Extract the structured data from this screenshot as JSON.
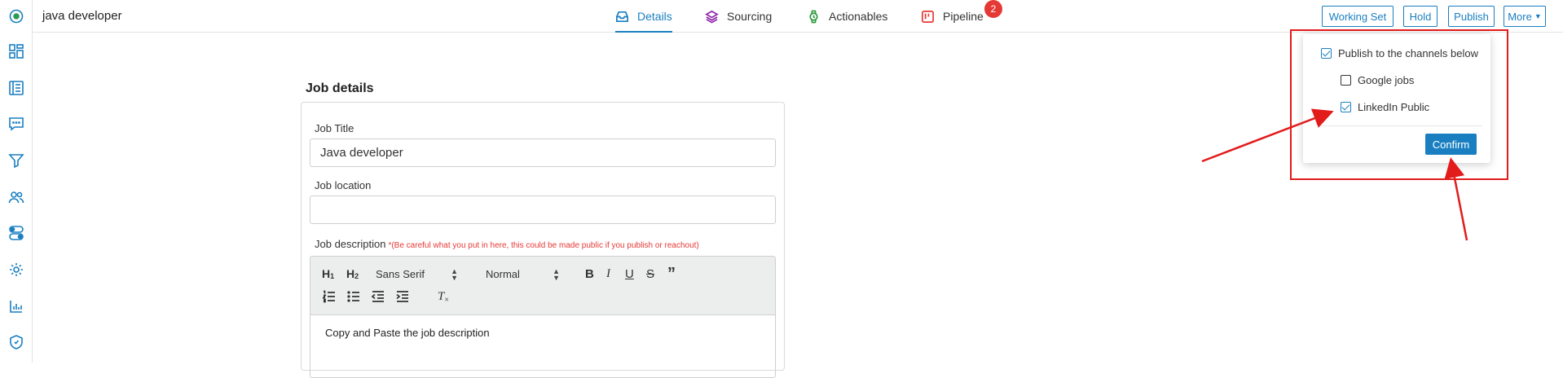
{
  "app": {
    "title": "java developer"
  },
  "sidebar": {
    "items": [
      {
        "name": "logo-icon"
      },
      {
        "name": "dashboard-icon"
      },
      {
        "name": "list-icon"
      },
      {
        "name": "chat-icon"
      },
      {
        "name": "filter-icon"
      },
      {
        "name": "users-icon"
      },
      {
        "name": "toggle-icon"
      },
      {
        "name": "gear-icon"
      },
      {
        "name": "chart-icon"
      },
      {
        "name": "shield-icon"
      }
    ]
  },
  "tabs": {
    "details": "Details",
    "sourcing": "Sourcing",
    "actionables": "Actionables",
    "pipeline": "Pipeline",
    "pipeline_badge": "2"
  },
  "header_buttons": {
    "working_set": "Working Set",
    "hold": "Hold",
    "publish": "Publish",
    "more": "More"
  },
  "job_details": {
    "section_title": "Job details",
    "job_title_label": "Job Title",
    "job_title_value": "Java developer",
    "job_location_label": "Job location",
    "job_location_value": "",
    "job_description_label": "Job description",
    "job_description_warning": "*(Be careful what you put in here, this could be made public if you publish or reachout)",
    "editor": {
      "font_select": "Sans Serif",
      "size_select": "Normal",
      "body_text": "Copy and Paste the job description"
    }
  },
  "publish_popup": {
    "main_label": "Publish to the channels below",
    "main_checked": true,
    "channels": [
      {
        "label": "Google jobs",
        "checked": false
      },
      {
        "label": "LinkedIn Public",
        "checked": true
      }
    ],
    "confirm_label": "Confirm"
  },
  "colors": {
    "accent": "#1a7fc1",
    "annotation_red": "#e21b1b",
    "badge_red": "#e53935"
  }
}
